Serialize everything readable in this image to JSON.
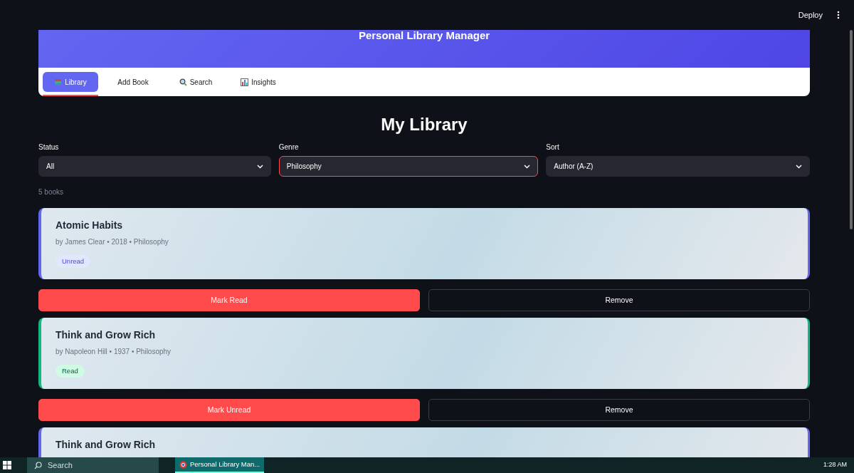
{
  "toolbar": {
    "deploy": "Deploy"
  },
  "header": {
    "title": "Personal Library Manager"
  },
  "tabs": [
    {
      "label": "Library",
      "selected": true
    },
    {
      "label": "Add Book",
      "selected": false
    },
    {
      "label": "Search",
      "selected": false
    },
    {
      "label": "Insights",
      "selected": false
    }
  ],
  "page_title": "My Library",
  "filters": [
    {
      "label": "Status",
      "value": "All",
      "focused": false
    },
    {
      "label": "Genre",
      "value": "Philosophy",
      "focused": true
    },
    {
      "label": "Sort",
      "value": "Author (A-Z)",
      "focused": false
    }
  ],
  "count": "5 books",
  "books": [
    {
      "title": "Atomic Habits",
      "meta": "by James Clear • 2018 • Philosophy",
      "status": "Unread",
      "read": false,
      "toggle": "Mark Read",
      "remove": "Remove"
    },
    {
      "title": "Think and Grow Rich",
      "meta": "by Napoleon Hill • 1937 • Philosophy",
      "status": "Read",
      "read": true,
      "toggle": "Mark Unread",
      "remove": "Remove"
    },
    {
      "title": "Think and Grow Rich",
      "read": false
    }
  ],
  "taskbar": {
    "search": "Search",
    "app": "Personal Library Man...",
    "time": "1:28 AM"
  }
}
